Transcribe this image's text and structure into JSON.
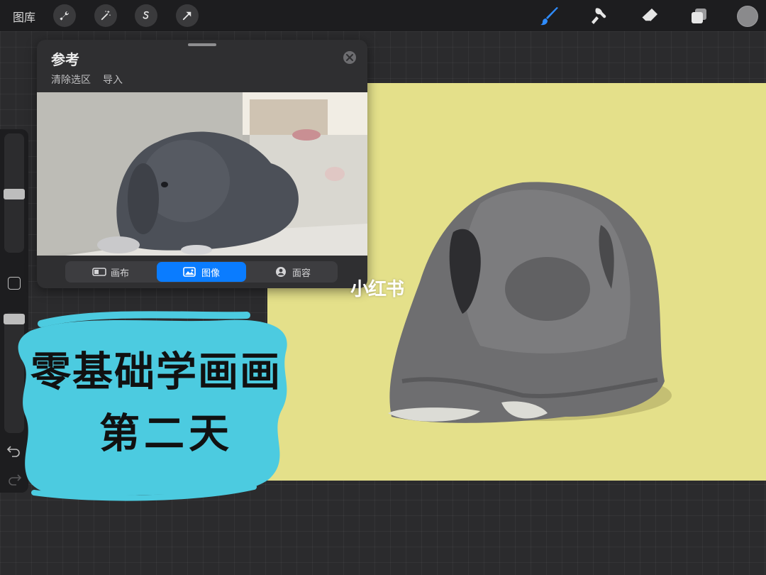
{
  "toolbar": {
    "gallery_label": "图库",
    "left_tools": [
      {
        "name": "wrench-icon"
      },
      {
        "name": "magic-wand-icon"
      },
      {
        "name": "selection-icon"
      },
      {
        "name": "transform-arrow-icon"
      }
    ],
    "right_tools": [
      {
        "name": "brush-icon",
        "active_color": "#2f8cff"
      },
      {
        "name": "smudge-icon"
      },
      {
        "name": "eraser-icon"
      },
      {
        "name": "layers-icon"
      }
    ],
    "current_color": "#8a8a8c"
  },
  "reference_panel": {
    "title": "参考",
    "actions": [
      "清除选区",
      "导入"
    ],
    "tabs": [
      {
        "label": "画布",
        "icon": "canvas-icon",
        "active": false
      },
      {
        "label": "图像",
        "icon": "image-icon",
        "active": true
      },
      {
        "label": "面容",
        "icon": "face-icon",
        "active": false
      }
    ]
  },
  "canvas": {
    "background": "#e4e08a"
  },
  "watermark": "小红书",
  "overlay": {
    "line1": "零基础学画画",
    "line2": "第二天",
    "blob_color": "#4ccbe0"
  },
  "colors": {
    "accent": "#0a7cff",
    "toolbar_bg": "#1d1d1f"
  }
}
